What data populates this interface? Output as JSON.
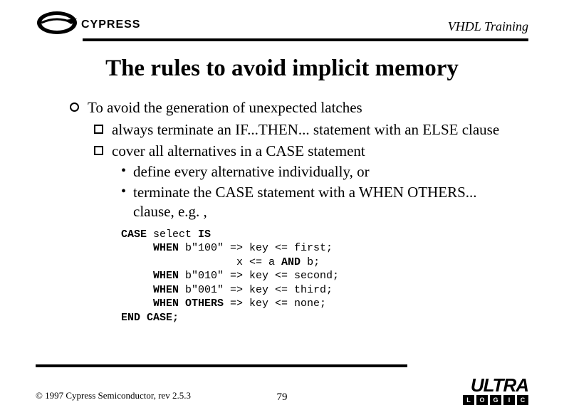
{
  "header": {
    "logo_text": "CYPRESS",
    "right_text": "VHDL Training"
  },
  "title": "The rules to avoid implicit memory",
  "bullets": {
    "main": "To avoid the generation of unexpected latches",
    "sub1": "always terminate an IF...THEN... statement with an ELSE clause",
    "sub2": "cover all alternatives in a CASE statement",
    "subsub1": "define every alternative individually, or",
    "subsub2": "terminate the CASE statement with a WHEN OTHERS... clause, e.g. ,"
  },
  "code": {
    "l1a": "CASE",
    "l1b": " select ",
    "l1c": "IS",
    "l2a": "     WHEN",
    "l2b": " b\"100\" => key <= first;",
    "l3": "                  x <= a ",
    "l3b": "AND",
    "l3c": " b;",
    "l4a": "     WHEN",
    "l4b": " b\"010\" => key <= second;",
    "l5a": "     WHEN",
    "l5b": " b\"001\" => key <= third;",
    "l6a": "     WHEN OTHERS",
    "l6b": " => key <= none;",
    "l7": "END CASE;"
  },
  "footer": {
    "copyright": "© 1997 Cypress Semiconductor, rev 2.5.3",
    "page": "79",
    "ultra": "ULTRA",
    "ultra_sub": [
      "L",
      "O",
      "G",
      "I",
      "C"
    ]
  }
}
